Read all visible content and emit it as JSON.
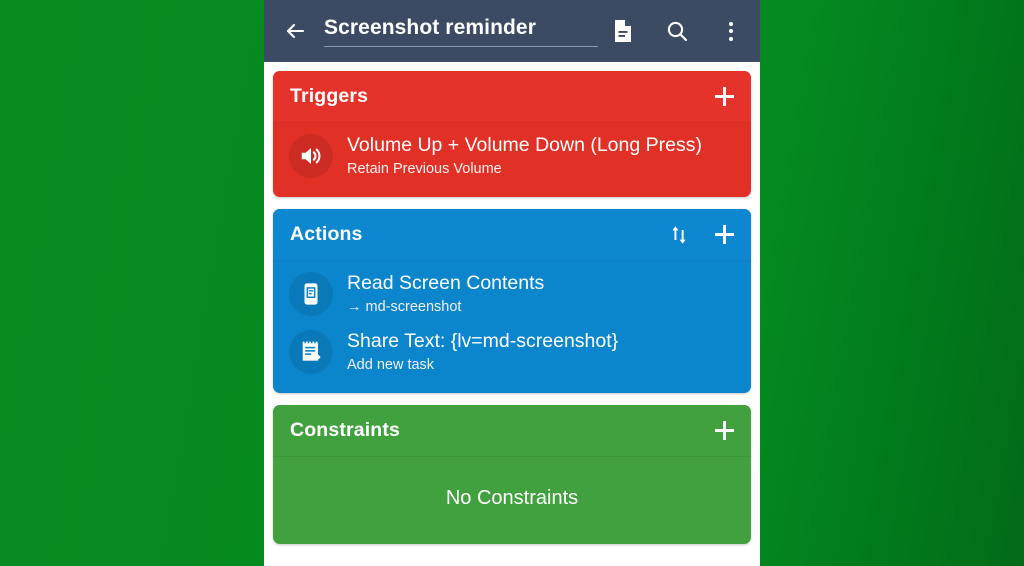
{
  "appbar": {
    "back_icon": "arrow-left-icon",
    "title": "Screenshot reminder",
    "document_icon": "document-icon",
    "search_icon": "search-icon",
    "overflow_icon": "more-vertical-icon"
  },
  "colors": {
    "appbar": "#3c4a63",
    "triggers": "#e13127",
    "actions": "#0b85cc",
    "constraints": "#41a13f",
    "background_green": "#018a1f",
    "panel": "#ffffff"
  },
  "cards": [
    {
      "id": "triggers",
      "title": "Triggers",
      "add_label": "+",
      "items": [
        {
          "icon": "volume-up-icon",
          "title": "Volume Up + Volume Down (Long Press)",
          "subtitle": "Retain Previous Volume"
        }
      ]
    },
    {
      "id": "actions",
      "title": "Actions",
      "sort_label": "sort-arrows-icon",
      "add_label": "+",
      "items": [
        {
          "icon": "read-screen-icon",
          "title": "Read Screen Contents",
          "subtitle": "→ md-screenshot"
        },
        {
          "icon": "share-text-icon",
          "title": "Share Text: {lv=md-screenshot}",
          "subtitle": "Add new task"
        }
      ]
    },
    {
      "id": "constraints",
      "title": "Constraints",
      "add_label": "+",
      "empty_message": "No Constraints",
      "items": []
    }
  ]
}
